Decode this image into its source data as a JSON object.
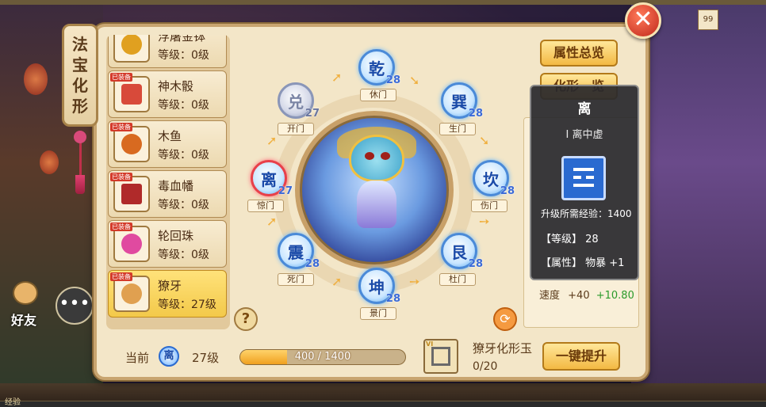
{
  "side_tab": {
    "title": "法宝化形"
  },
  "items": [
    {
      "name": "浮屠金钵",
      "level": "等级：0级",
      "badge": "",
      "art_color": "#e0a020"
    },
    {
      "name": "神木骰",
      "level": "等级：0级",
      "badge": "已装备",
      "art_color": "#d84a3a"
    },
    {
      "name": "木鱼",
      "level": "等级：0级",
      "badge": "已装备",
      "art_color": "#d86a20"
    },
    {
      "name": "毒血幡",
      "level": "等级：0级",
      "badge": "已装备",
      "art_color": "#b02a2a"
    },
    {
      "name": "轮回珠",
      "level": "等级：0级",
      "badge": "已装备",
      "art_color": "#e04aa0"
    },
    {
      "name": "獠牙",
      "level": "等级：27级",
      "badge": "已装备",
      "art_color": "#e0a050"
    }
  ],
  "nodes": {
    "qian": {
      "glyph": "乾",
      "level": "28",
      "gate": "休门"
    },
    "xun": {
      "glyph": "巽",
      "level": "28",
      "gate": "生门"
    },
    "kan": {
      "glyph": "坎",
      "level": "28",
      "gate": "伤门"
    },
    "gen": {
      "glyph": "艮",
      "level": "28",
      "gate": "杜门"
    },
    "kun": {
      "glyph": "坤",
      "level": "28",
      "gate": "景门"
    },
    "zhen": {
      "glyph": "震",
      "level": "28",
      "gate": "死门"
    },
    "li": {
      "glyph": "离",
      "level": "27",
      "gate": "惊门"
    },
    "dui": {
      "glyph": "兑",
      "level": "27",
      "gate": "开门"
    }
  },
  "buttons": {
    "attr_overview": "属性总览",
    "form_overview": "化形一览",
    "upgrade": "一键提升",
    "help": "?",
    "close": "✕"
  },
  "stats": {
    "speed_label": "速度",
    "speed_base": "+40",
    "speed_bonus": "+10.80"
  },
  "tooltip": {
    "title": "离",
    "subtitle": "Ⅰ 离中虚",
    "exp": "升级所需经验：1400",
    "level": "【等级】 28",
    "attr": "【属性】 物暴 +1"
  },
  "bottom": {
    "current_label": "当前",
    "current_glyph": "离",
    "current_level": "27级",
    "progress_text": "400 / 1400",
    "progress_value": 400,
    "progress_max": 1400,
    "jade_name": "獠牙化形玉",
    "jade_count": "0/20",
    "jade_tag": "VI"
  },
  "hud": {
    "friend": "好友",
    "exp_label": "经验",
    "top_right": "99"
  }
}
